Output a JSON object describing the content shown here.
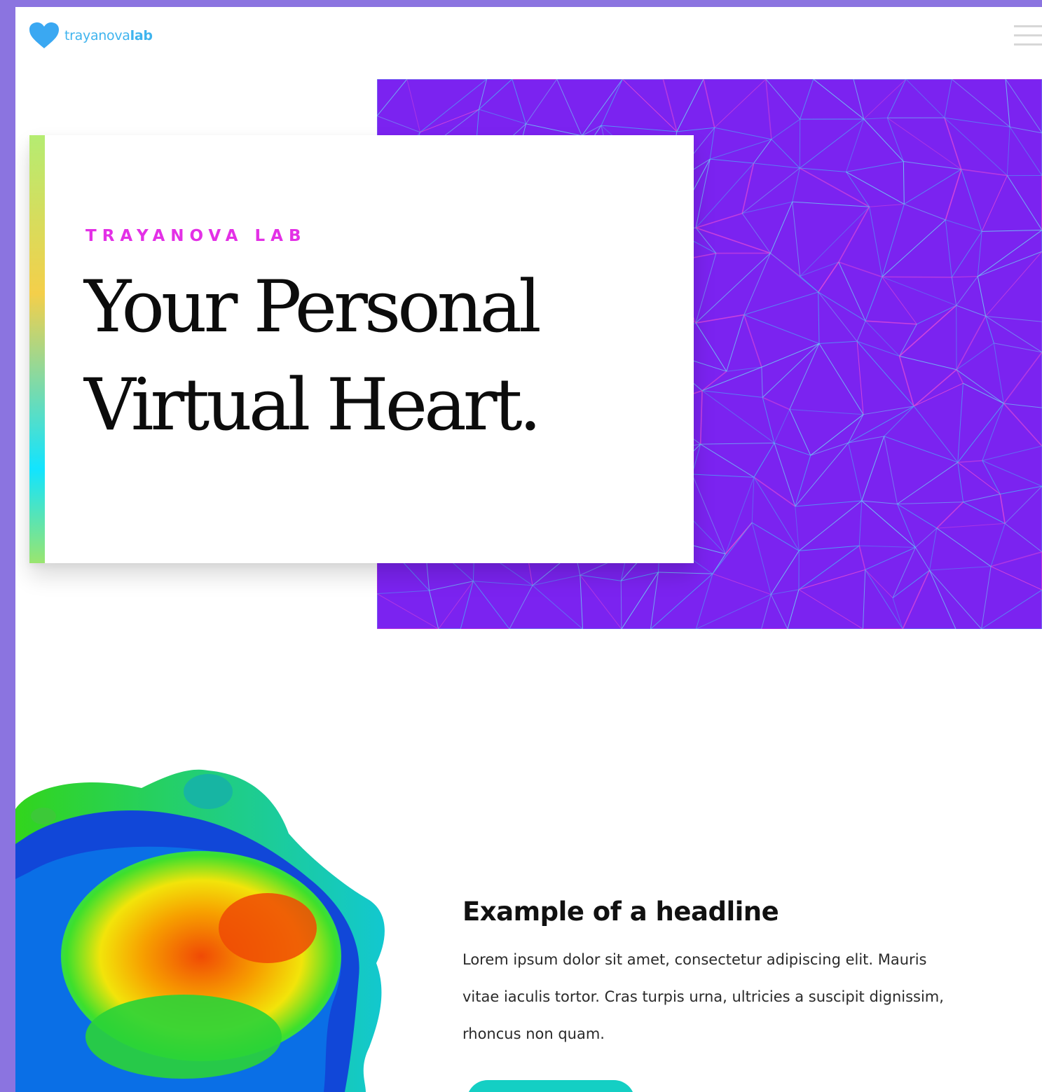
{
  "brand": {
    "logo_regular": "trayanova",
    "logo_bold": "lab",
    "logo_color": "#3fb4ee"
  },
  "header": {
    "menu_icon": "hamburger-menu-icon"
  },
  "hero": {
    "eyebrow": "TRAYANOVA LAB",
    "title_line1": "Your Personal",
    "title_line2": "Virtual Heart.",
    "background_color": "#7b23f0",
    "eyebrow_color": "#e330e6"
  },
  "feature": {
    "image": "heart-simulation-image",
    "headline": "Example of a headline",
    "body": "Lorem ipsum dolor sit amet, consectetur adipiscing elit. Mauris vitae iaculis tortor. Cras turpis urna, ultricies a suscipit dignissim, rhoncus non quam.",
    "cta_color": "#14cfc4"
  }
}
